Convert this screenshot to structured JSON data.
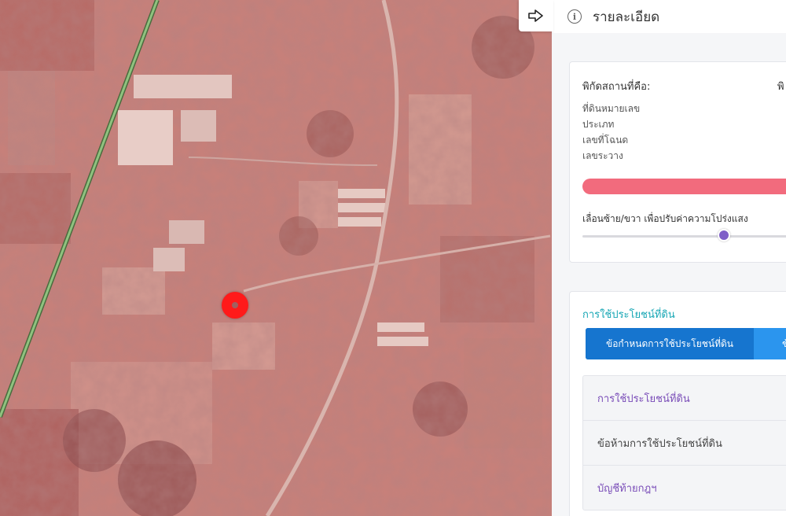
{
  "panel": {
    "title": "รายละเอียด",
    "info_icon": "info-icon",
    "collapse_icon": "arrow-right-icon"
  },
  "coordinates": {
    "label": "พิกัดสถานที่คือ:",
    "value_fragment": "พิ",
    "fields": [
      "ที่ดินหมายเลข",
      "ประเภท",
      "เลขที่โฉนด",
      "เลขระวาง"
    ],
    "opacity_bar_color": "#f26b7d",
    "slider_label": "เลื่อนซ้าย/ขวา เพื่อปรับค่าความโปร่งแสง",
    "slider_value_percent": 62
  },
  "landuse": {
    "title": "การใช้ประโยชน์ที่ดิน",
    "tabs": [
      "ข้อกำหนดการใช้ประโยชน์ที่ดิน",
      "ข้"
    ],
    "active_tab": 0,
    "items": [
      {
        "label": "การใช้ประโยชน์ที่ดิน",
        "style": "purple"
      },
      {
        "label": "ข้อห้ามการใช้ประโยชน์ที่ดิน",
        "style": "gray"
      },
      {
        "label": "บัญชีท้ายกฎฯ",
        "style": "purple"
      }
    ]
  },
  "colors": {
    "accent_teal": "#18a7b5",
    "tab_blue": "#2b95ee",
    "tab_active": "#1675cf",
    "marker_red": "#ff1a1a",
    "slider_thumb": "#7e5ec7",
    "item_purple": "#7a4db8"
  },
  "map": {
    "type": "satellite-overlay",
    "marker": "location-marker"
  }
}
